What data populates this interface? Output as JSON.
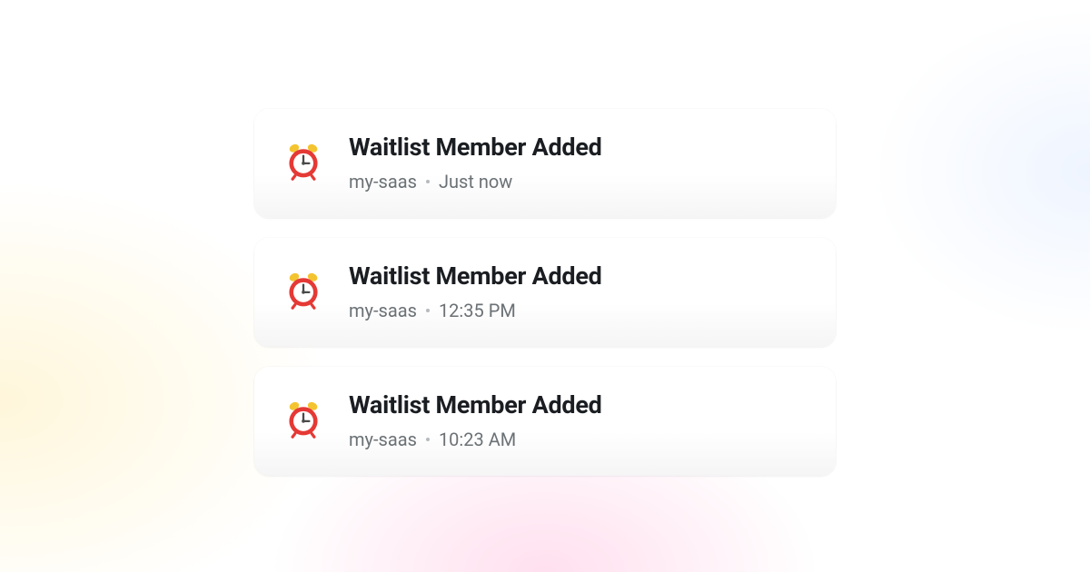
{
  "notifications": [
    {
      "icon": "alarm-clock",
      "title": "Waitlist Member Added",
      "source": "my-saas",
      "time": "Just now"
    },
    {
      "icon": "alarm-clock",
      "title": "Waitlist Member Added",
      "source": "my-saas",
      "time": "12:35 PM"
    },
    {
      "icon": "alarm-clock",
      "title": "Waitlist Member Added",
      "source": "my-saas",
      "time": "10:23 AM"
    }
  ]
}
